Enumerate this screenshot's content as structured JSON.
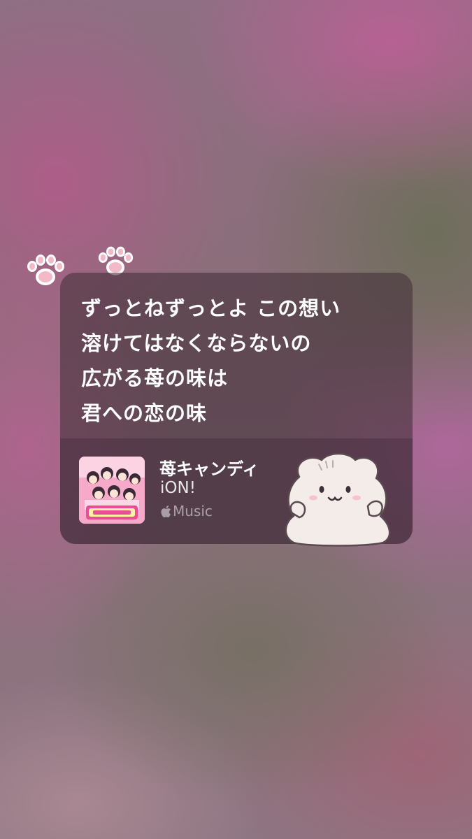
{
  "lyrics": {
    "lines": [
      "ずっとねずっとよ この想い",
      "溶けてはなくならないの",
      "広がる苺の味は",
      "君への恋の味"
    ]
  },
  "track": {
    "title": "苺キャンディ",
    "artist": "iON!",
    "source": "Music",
    "artwork_icon": "album-artwork"
  },
  "stickers": {
    "paw_icon": "paw-print-icon",
    "cat_icon": "white-fluffy-cat-sticker"
  },
  "colors": {
    "card_bg": "#44303a",
    "text_primary": "#ffffff",
    "text_secondary": "#ffffff80",
    "paw_pink": "#f2b9c8"
  }
}
